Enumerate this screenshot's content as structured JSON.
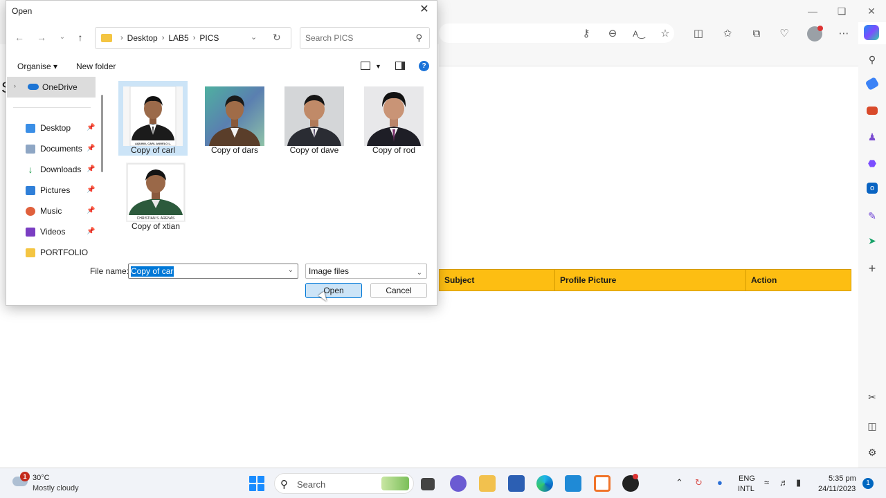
{
  "dialog": {
    "title": "Open",
    "path": [
      "Desktop",
      "LAB5",
      "PICS"
    ],
    "search_placeholder": "Search PICS",
    "organise_label": "Organise ▾",
    "new_folder_label": "New folder",
    "nav_items": [
      {
        "label": "OneDrive",
        "icon": "onedrive-icon"
      },
      {
        "label": "Desktop",
        "icon": "desktop-icon"
      },
      {
        "label": "Documents",
        "icon": "documents-icon"
      },
      {
        "label": "Downloads",
        "icon": "downloads-icon"
      },
      {
        "label": "Pictures",
        "icon": "pictures-icon"
      },
      {
        "label": "Music",
        "icon": "music-icon"
      },
      {
        "label": "Videos",
        "icon": "videos-icon"
      },
      {
        "label": "PORTFOLIO",
        "icon": "folder-icon"
      }
    ],
    "files": [
      {
        "label": "Copy of carl",
        "caption": "AQUINO, CARL ANGELO L.",
        "selected": true
      },
      {
        "label": "Copy of dars",
        "caption": ""
      },
      {
        "label": "Copy of dave",
        "caption": ""
      },
      {
        "label": "Copy of rod",
        "caption": ""
      },
      {
        "label": "Copy of xtian",
        "caption": "CHRISTIAN S. ARENAS"
      }
    ],
    "file_name_label": "File name:",
    "file_name_value": "Copy of carl",
    "file_type": "Image files",
    "open_button": "Open",
    "cancel_button": "Cancel"
  },
  "page": {
    "heading_partial": "S",
    "table_headers": [
      "Subject",
      "Profile Picture",
      "Action"
    ],
    "table_header_color": "#fdbe12"
  },
  "taskbar": {
    "temperature": "30°C",
    "condition": "Mostly cloudy",
    "weather_badge": "1",
    "search_label": "Search",
    "lang_top": "ENG",
    "lang_bottom": "INTL",
    "time": "5:35 pm",
    "date": "24/11/2023",
    "notification_count": "1"
  }
}
